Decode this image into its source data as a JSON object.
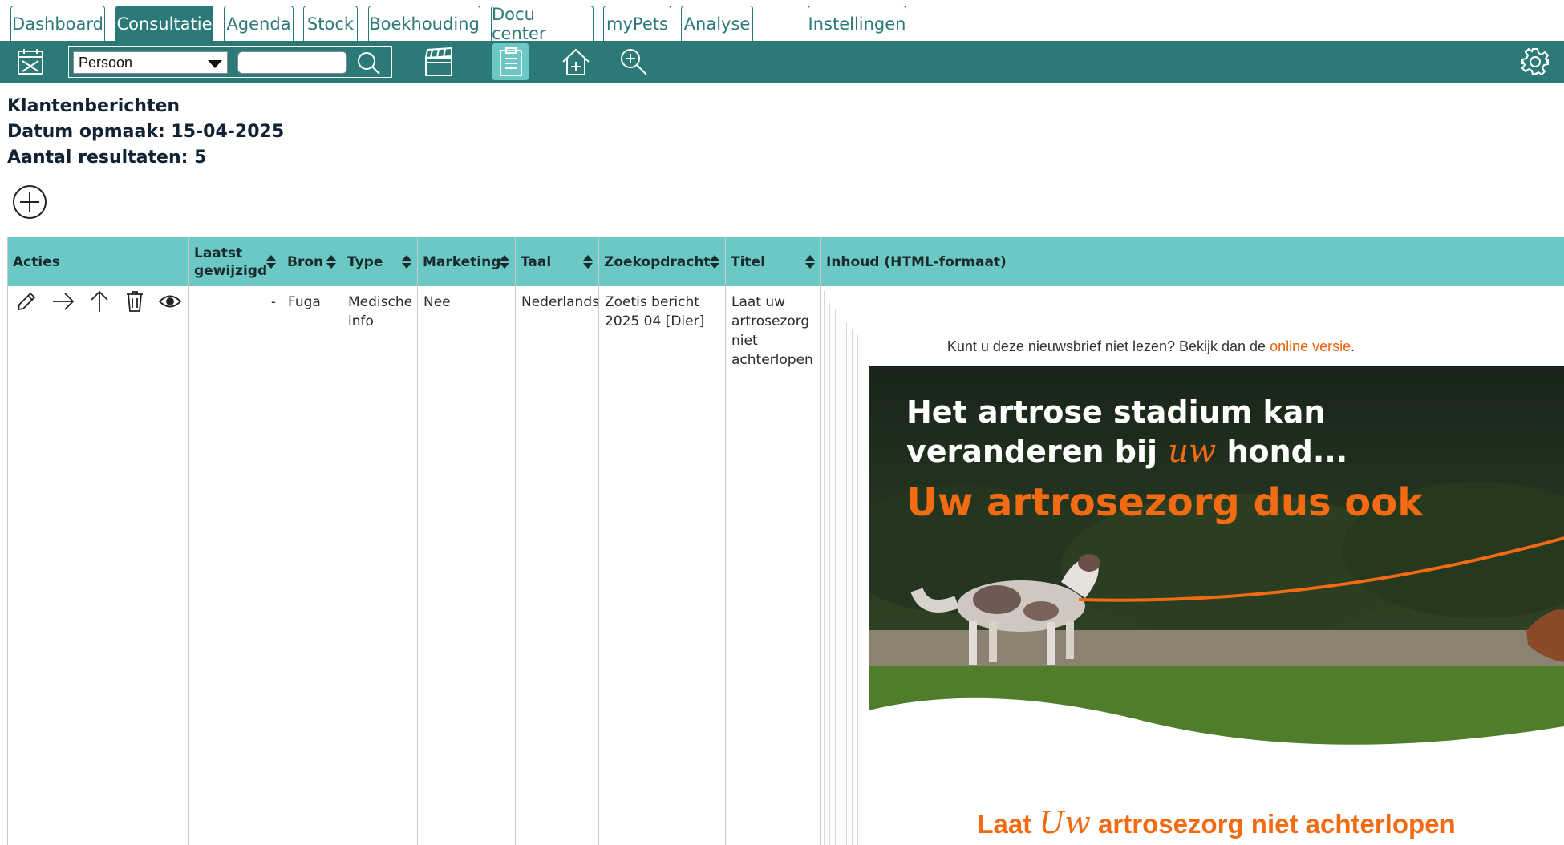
{
  "tabs": [
    {
      "label": "Dashboard",
      "active": false
    },
    {
      "label": "Consultatie",
      "active": true
    },
    {
      "label": "Agenda",
      "active": false
    },
    {
      "label": "Stock",
      "active": false
    },
    {
      "label": "Boekhouding",
      "active": false
    },
    {
      "label": "Docu center",
      "active": false
    },
    {
      "label": "myPets",
      "active": false
    },
    {
      "label": "Analyse",
      "active": false
    },
    {
      "label": "Instellingen",
      "active": false
    }
  ],
  "toolbar": {
    "search_type": "Persoon",
    "search_value": "",
    "icons": [
      "calendar-icon",
      "search-icon",
      "clapperboard-icon",
      "clipboard-icon",
      "home-add-icon",
      "zoom-in-icon",
      "gear-icon"
    ]
  },
  "report": {
    "title": "Klantenberichten",
    "date_line": "Datum opmaak: 15-04-2025",
    "count_line": "Aantal resultaten: 5"
  },
  "table": {
    "headers": [
      "Acties",
      "Laatst gewijzigd",
      "Bron",
      "Type",
      "Marketing",
      "Taal",
      "Zoekopdracht",
      "Titel",
      "Inhoud (HTML-formaat)"
    ],
    "rows": [
      {
        "last_modified": "-",
        "source": "Fuga",
        "type": "Medische info",
        "marketing": "Nee",
        "language": "Nederlands",
        "query": "Zoetis bericht 2025 04 [Dier]",
        "title": "Laat uw artrosezorg niet achterlopen"
      }
    ]
  },
  "newsletter": {
    "notice_prefix": "Kunt u deze nieuwsbrief niet lezen? Bekijk dan de",
    "notice_link": "online versie",
    "notice_suffix": ".",
    "hero_line1": "Het artrose stadium kan",
    "hero_line2_pre": "veranderen bij",
    "hero_line2_script": "uw",
    "hero_line2_post": "hond...",
    "hero_line3": "Uw artrosezorg dus ook",
    "bottom_pre": "Laat",
    "bottom_script": "Uw",
    "bottom_post": "artrosezorg niet achterlopen",
    "accent_color": "#f26a12"
  },
  "colors": {
    "brand": "#2b7a77",
    "header": "#6cc8c4"
  }
}
